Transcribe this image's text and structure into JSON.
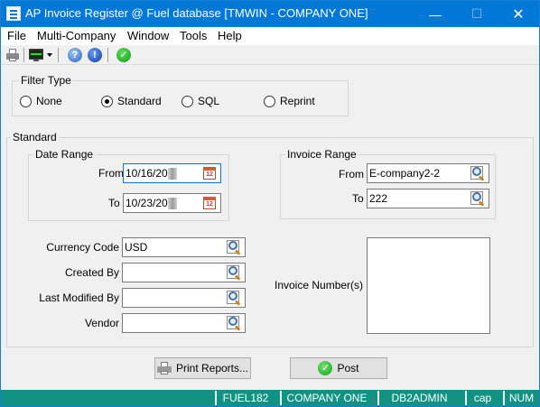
{
  "window": {
    "title": "AP Invoice Register @ Fuel database [TMWIN - COMPANY ONE]",
    "minimize_glyph": "—",
    "maximize_glyph": "☐",
    "close_glyph": "✕"
  },
  "menu": {
    "items": [
      "File",
      "Multi-Company",
      "Window",
      "Tools",
      "Help"
    ]
  },
  "toolbar": {
    "icons": [
      "printer-icon",
      "monitor-icon",
      "dropdown-arrow",
      "help-icon",
      "info-icon",
      "ok-icon"
    ],
    "help_glyph": "?",
    "info_glyph": "!",
    "ok_glyph": "✓"
  },
  "filter_type": {
    "label": "Filter Type",
    "options": [
      "None",
      "Standard",
      "SQL",
      "Reprint"
    ],
    "selected": "Standard"
  },
  "standard": {
    "label": "Standard",
    "date_range": {
      "label": "Date Range",
      "from_label": "From",
      "from_value": "10/16/20",
      "to_label": "To",
      "to_value": "10/23/20",
      "calendar_day": "12"
    },
    "invoice_range": {
      "label": "Invoice Range",
      "from_label": "From",
      "from_value": "E-company2-2",
      "to_label": "To",
      "to_value": "222"
    },
    "currency_code": {
      "label": "Currency Code",
      "value": "USD"
    },
    "created_by": {
      "label": "Created By",
      "value": ""
    },
    "last_modified_by": {
      "label": "Last Modified By",
      "value": ""
    },
    "vendor": {
      "label": "Vendor",
      "value": ""
    },
    "invoice_numbers": {
      "label": "Invoice Number(s)"
    }
  },
  "buttons": {
    "print_reports": "Print Reports...",
    "post": "Post"
  },
  "status_bar": {
    "panels": [
      "FUEL182",
      "COMPANY ONE",
      "DB2ADMIN",
      "cap",
      "NUM"
    ]
  },
  "colors": {
    "title_bar": "#0078d7",
    "status_bar": "#119282",
    "window_bg": "#f0f0f0"
  }
}
